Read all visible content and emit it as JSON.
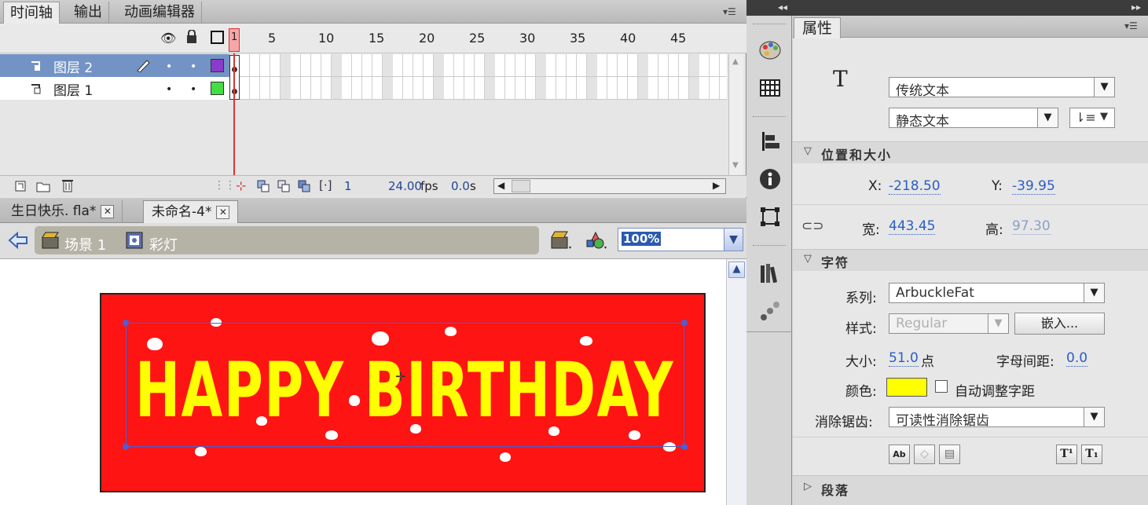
{
  "timeline_panel": {
    "tabs": [
      "时间轴",
      "输出",
      "动画编辑器"
    ],
    "frame_numbers": [
      "1",
      "5",
      "10",
      "15",
      "20",
      "25",
      "30",
      "35",
      "40",
      "45"
    ],
    "layers": [
      {
        "name": "图层 2",
        "color": "#8b3bc9",
        "selected": true
      },
      {
        "name": "图层 1",
        "color": "#44dd44",
        "selected": false
      }
    ],
    "footer": {
      "frame": "1",
      "fps": "24.00",
      "fps_unit": "fps",
      "time": "0.0",
      "time_unit": "s"
    }
  },
  "document_tabs": [
    {
      "label": "生日快乐. fla*",
      "active": false
    },
    {
      "label": "未命名-4*",
      "active": true
    }
  ],
  "edit_bar": {
    "crumbs": [
      "场景 1",
      "彩灯"
    ],
    "zoom": "100%"
  },
  "stage": {
    "banner_color": "#ff1414",
    "text": "HAPPY BIRTHDAY",
    "text_color": "#ffff00"
  },
  "properties": {
    "tab": "属性",
    "text_icon": "T",
    "text_engine": "传统文本",
    "text_type": "静态文本",
    "position_section": "位置和大小",
    "x_label": "X:",
    "x_value": "-218.50",
    "y_label": "Y:",
    "y_value": "-39.95",
    "w_label": "宽:",
    "w_value": "443.45",
    "h_label": "高:",
    "h_value": "97.30",
    "char_section": "字符",
    "family_label": "系列:",
    "family_value": "ArbuckleFat",
    "style_label": "样式:",
    "style_value": "Regular",
    "embed_button": "嵌入...",
    "size_label": "大小:",
    "size_value": "51.0",
    "size_unit": "点",
    "spacing_label": "字母间距:",
    "spacing_value": "0.0",
    "color_label": "颜色:",
    "color_value": "#ffff00",
    "autokern_label": "自动调整字距",
    "antialias_label": "消除锯齿:",
    "antialias_value": "可读性消除锯齿",
    "paragraph_section": "段落"
  }
}
